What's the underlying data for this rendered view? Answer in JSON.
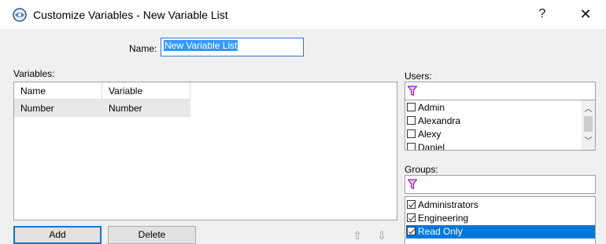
{
  "window": {
    "title": "Customize Variables - New Variable List",
    "help_label": "?",
    "close_label": "✕"
  },
  "name_field": {
    "label": "Name:",
    "value": "New Variable List"
  },
  "variables": {
    "label": "Variables:",
    "columns": [
      "Name",
      "Variable"
    ],
    "rows": [
      [
        "Number",
        "Number"
      ]
    ]
  },
  "buttons": {
    "add": "Add",
    "delete": "Delete",
    "move_up": "⇧",
    "move_down": "⇩"
  },
  "users": {
    "label": "Users:",
    "filter_icon": "filter-icon",
    "items": [
      {
        "label": "Admin",
        "checked": false
      },
      {
        "label": "Alexandra",
        "checked": false
      },
      {
        "label": "Alexy",
        "checked": false
      },
      {
        "label": "Daniel",
        "checked": false
      }
    ]
  },
  "groups": {
    "label": "Groups:",
    "filter_icon": "filter-icon",
    "items": [
      {
        "label": "Administrators",
        "checked": true
      },
      {
        "label": "Engineering",
        "checked": true
      },
      {
        "label": "Read Only",
        "checked": true,
        "selected": true
      }
    ]
  },
  "colors": {
    "accent": "#0078d7",
    "filter": "#a01cc0"
  }
}
